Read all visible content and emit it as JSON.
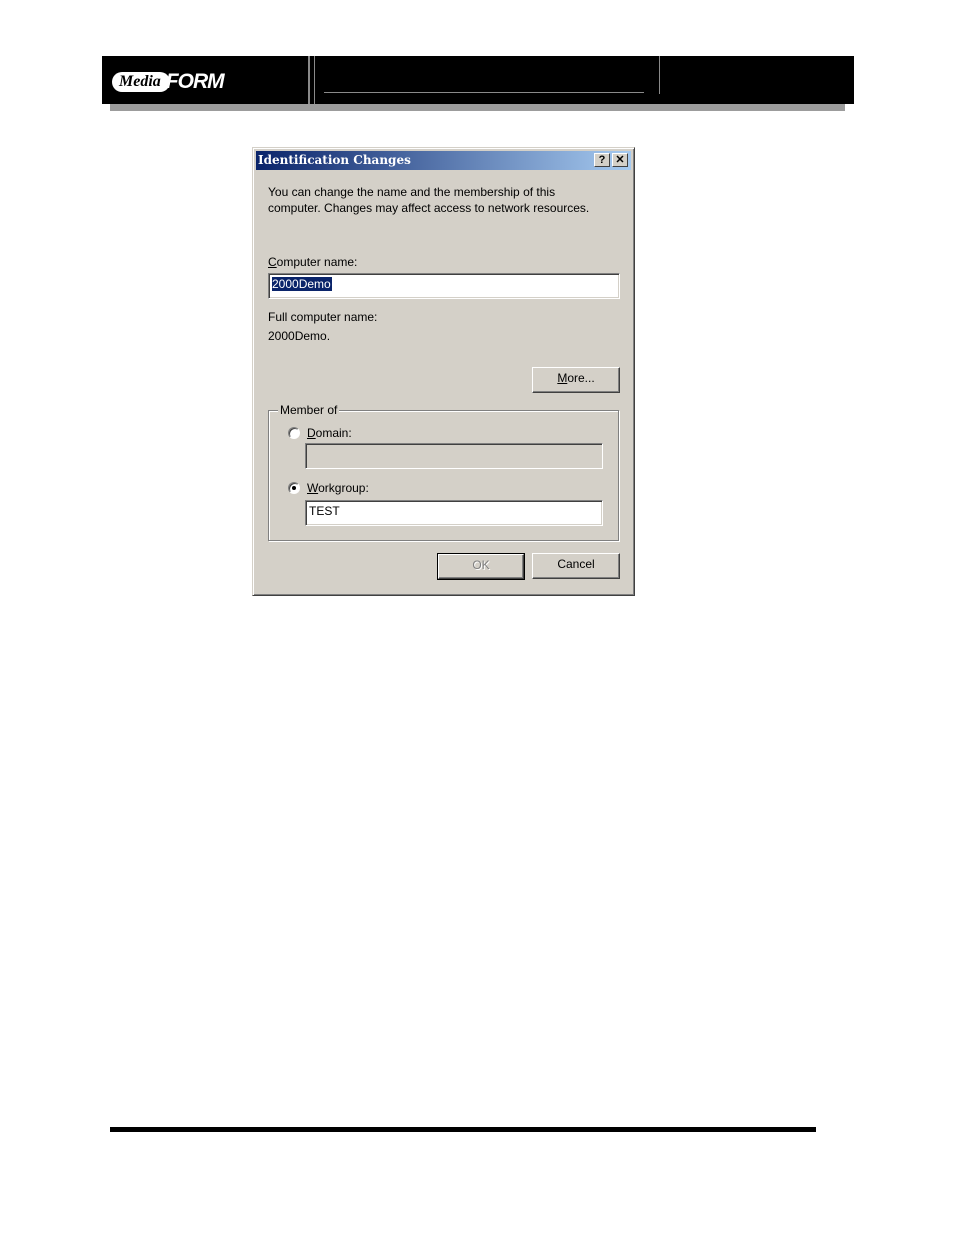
{
  "header": {
    "logo_media": "Media",
    "logo_form": "FORM"
  },
  "dialog": {
    "title": "Identification Changes",
    "help_glyph": "?",
    "close_glyph": "✕",
    "description_line1": "You can change the name and the membership of this",
    "description_line2": "computer. Changes may affect access to network resources.",
    "computer_name": {
      "label_accel": "C",
      "label_rest": "omputer name:",
      "value": "2000Demo"
    },
    "full_computer_name": {
      "label": "Full computer name:",
      "value": "2000Demo."
    },
    "more_button": {
      "accel": "M",
      "rest": "ore..."
    },
    "member_of": {
      "legend": "Member of",
      "domain": {
        "accel": "D",
        "rest": "omain:",
        "selected": false,
        "value": ""
      },
      "workgroup": {
        "accel": "W",
        "rest": "orkgroup:",
        "selected": true,
        "value": "TEST"
      }
    },
    "ok_button": "OK",
    "cancel_button": "Cancel"
  },
  "colors": {
    "title_gradient_start": "#0a246a",
    "title_gradient_end": "#a6caf0",
    "dialog_face": "#d4d0c8"
  }
}
